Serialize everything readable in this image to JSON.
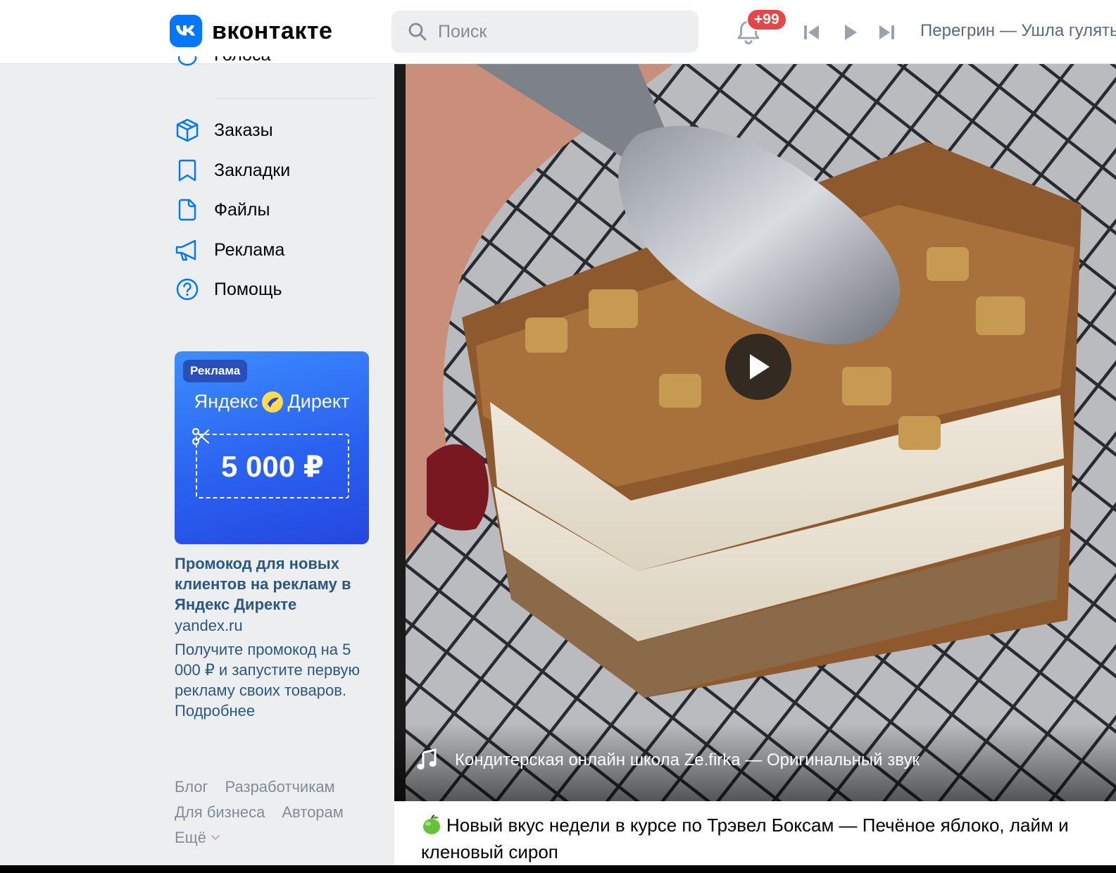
{
  "header": {
    "logo_text": "вконтакте",
    "search_placeholder": "Поиск",
    "notifications_badge": "+99",
    "now_playing": "Перегрин — Ушла гулять"
  },
  "sidebar": {
    "partial_item": "Голоса",
    "items": [
      {
        "label": "Заказы",
        "icon": "box-icon"
      },
      {
        "label": "Закладки",
        "icon": "bookmark-icon"
      },
      {
        "label": "Файлы",
        "icon": "file-icon"
      },
      {
        "label": "Реклама",
        "icon": "megaphone-icon"
      },
      {
        "label": "Помощь",
        "icon": "help-icon"
      }
    ]
  },
  "ad": {
    "tag": "Реклама",
    "brand_left": "Яндекс",
    "brand_right": "Директ",
    "coupon": "5 000 ₽",
    "title": "Промокод для новых клиентов на рекламу в Яндекс Директе",
    "domain": "yandex.ru",
    "text": "Получите промокод на 5 000 ₽ и запустите первую рекламу своих товаров. Подробнее"
  },
  "footer": {
    "links": [
      "Блог",
      "Разработчикам",
      "Для бизнеса",
      "Авторам"
    ],
    "more": "Ещё"
  },
  "post": {
    "audio": "Кондитерская онлайн школа Ze.firka — Оригинальный звук",
    "text": "Новый вкус недели в курсе по Трэвел Боксам — Печёное яблоко, лайм и кленовый сироп"
  },
  "colors": {
    "accent": "#0077ff",
    "link": "#2a5885",
    "muted": "#818c99",
    "badge": "#e64646"
  }
}
